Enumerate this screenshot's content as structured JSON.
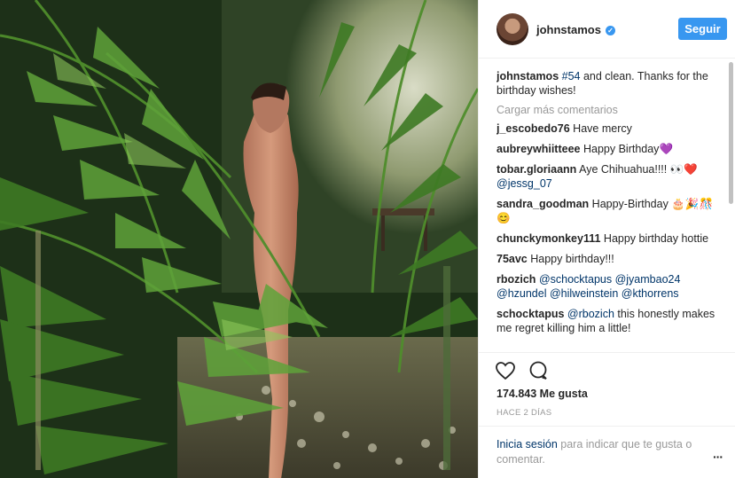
{
  "header": {
    "username": "johnstamos",
    "follow_label": "Seguir"
  },
  "caption": {
    "user": "johnstamos",
    "hashtag": "#54",
    "text": " and clean. Thanks for the birthday wishes!"
  },
  "load_more": "Cargar más comentarios",
  "comments": [
    {
      "user": "j_escobedo76",
      "text": "Have mercy"
    },
    {
      "user": "aubreywhiitteee",
      "text": "Happy Birthday",
      "emoji": "💜"
    },
    {
      "user": "tobar.gloriaann",
      "text": "Aye Chihuahua!!!! ",
      "emoji": "👀❤️",
      "mention": "@jessg_07"
    },
    {
      "user": "sandra_goodman",
      "text": "Happy-Birthday",
      "emoji": "🎂🎉🎊😊"
    },
    {
      "user": "chunckymonkey111",
      "text": "Happy birthday hottie"
    },
    {
      "user": "75avc",
      "text": "Happy birthday!!!"
    },
    {
      "user": "rbozich",
      "mentions": [
        "@schocktapus",
        "@jyambao24",
        "@hzundel",
        "@hilweinstein",
        "@kthorrens"
      ]
    },
    {
      "user": "schocktapus",
      "mention": "@rbozich",
      "text": " this honestly makes me regret killing him a little!"
    }
  ],
  "likes": "174.843 Me gusta",
  "time": "HACE 2 DÍAS",
  "login": {
    "link": "Inicia sesión",
    "text": " para indicar que te gusta o comentar."
  },
  "more_label": "···",
  "colors": {
    "accent": "#3897f0",
    "link": "#003569",
    "muted": "#999999"
  },
  "icons": [
    "heart-icon",
    "comment-icon",
    "verified-icon",
    "more-options-icon"
  ]
}
